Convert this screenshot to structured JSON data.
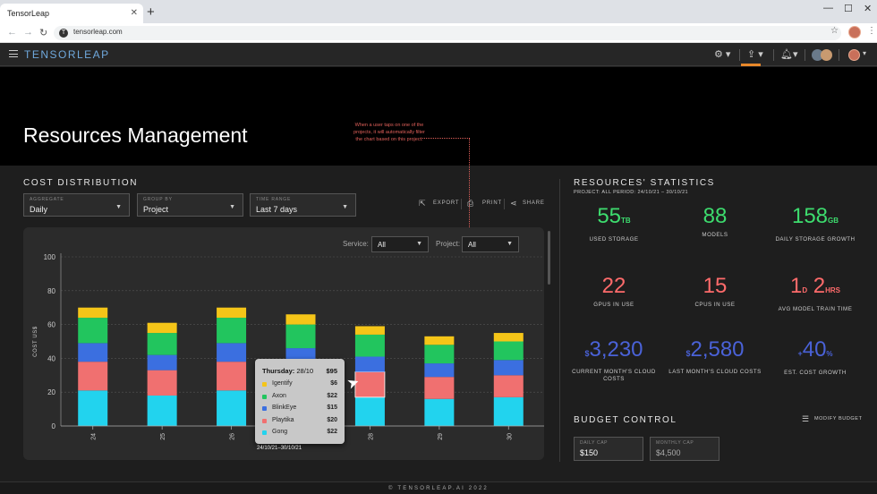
{
  "browser": {
    "tab_title": "TensorLeap",
    "tab_close": "✕",
    "new_tab": "+",
    "url": "tensorleap.com",
    "site_icon_letter": "T"
  },
  "app": {
    "brand": "TENSORLEAP",
    "page_title": "Resources Management",
    "annotation": "When a user taps on one of the projects, it will automatically filter the chart based on this project."
  },
  "cost": {
    "title": "COST DISTRIBUTION",
    "aggregate": {
      "label": "AGGREGATE",
      "value": "Daily"
    },
    "group_by": {
      "label": "GROUP BY",
      "value": "Project"
    },
    "time_range": {
      "label": "TIME RANGE",
      "value": "Last 7 days"
    },
    "export_label": "EXPORT",
    "print_label": "PRINT",
    "share_label": "SHARE",
    "service_label": "Service:",
    "service_value": "All",
    "project_label": "Project:",
    "project_value": "All"
  },
  "tooltip": {
    "day": "Thursday:",
    "date": "28/10",
    "total": "$95",
    "rows": [
      {
        "name": "Igentify",
        "value": "$6",
        "color": "#f5c518"
      },
      {
        "name": "Axon",
        "value": "$22",
        "color": "#22c55e"
      },
      {
        "name": "BlinkEye",
        "value": "$15",
        "color": "#3b6fe0"
      },
      {
        "name": "Playtika",
        "value": "$20",
        "color": "#f07070"
      },
      {
        "name": "Gong",
        "value": "$22",
        "color": "#22d3ee"
      }
    ],
    "range": "24/10/21–30/10/21"
  },
  "chart_data": {
    "type": "bar",
    "stacked": true,
    "categories": [
      "24",
      "25",
      "26",
      "27",
      "28",
      "29",
      "30"
    ],
    "ylabel": "COST US$",
    "ylim": [
      0,
      100
    ],
    "yticks": [
      0,
      20,
      40,
      60,
      80,
      100
    ],
    "grid": true,
    "series": [
      {
        "name": "Gong",
        "color": "#22d3ee",
        "values": [
          21,
          18,
          21,
          20,
          17,
          16,
          17
        ]
      },
      {
        "name": "Playtika",
        "color": "#f07070",
        "values": [
          17,
          15,
          17,
          16,
          15,
          13,
          13
        ]
      },
      {
        "name": "BlinkEye",
        "color": "#3b6fe0",
        "values": [
          11,
          9,
          11,
          10,
          9,
          8,
          9
        ]
      },
      {
        "name": "Axon",
        "color": "#22c55e",
        "values": [
          15,
          13,
          15,
          14,
          13,
          11,
          11
        ]
      },
      {
        "name": "Igentify",
        "color": "#f5c518",
        "values": [
          6,
          6,
          6,
          6,
          5,
          5,
          5
        ]
      }
    ],
    "highlight_index": 4
  },
  "resources": {
    "title": "RESOURCES' STATISTICS",
    "subtitle": "PROJECT: ALL   PERIOD: 24/10/21 – 30/10/21",
    "stats": [
      {
        "prefix": "",
        "value": "55",
        "unit": "TB",
        "label": "USED STORAGE",
        "color": "green"
      },
      {
        "prefix": "",
        "value": "88",
        "unit": "",
        "label": "MODELS",
        "color": "green"
      },
      {
        "prefix": "",
        "value": "158",
        "unit": "GB",
        "label": "DAILY STORAGE GROWTH",
        "color": "green"
      },
      {
        "prefix": "",
        "value": "22",
        "unit": "",
        "label": "GPUS IN USE",
        "color": "red"
      },
      {
        "prefix": "",
        "value": "15",
        "unit": "",
        "label": "CPUS IN USE",
        "color": "red"
      },
      {
        "prefix": "",
        "value": "1",
        "unit": "D",
        "value2": "2",
        "unit2": "HRS",
        "label": "AVG MODEL TRAIN TIME",
        "color": "red"
      },
      {
        "prefix": "$",
        "value": "3,230",
        "unit": "",
        "label": "CURRENT MONTH'S CLOUD COSTS",
        "color": "blue"
      },
      {
        "prefix": "$",
        "value": "2,580",
        "unit": "",
        "label": "LAST MONTH'S CLOUD COSTS",
        "color": "blue"
      },
      {
        "prefix": "+",
        "value": "40",
        "unit": "%",
        "label": "EST. COST GROWTH",
        "color": "blue"
      }
    ]
  },
  "budget": {
    "title": "BUDGET CONTROL",
    "modify_label": "MODIFY BUDGET",
    "daily_cap_label": "DAILY CAP",
    "daily_cap_value": "$150",
    "monthly_cap_label": "MONTHLY CAP",
    "monthly_cap_value": "$4,500"
  },
  "footer": "© TENSORLEAP.AI 2022"
}
